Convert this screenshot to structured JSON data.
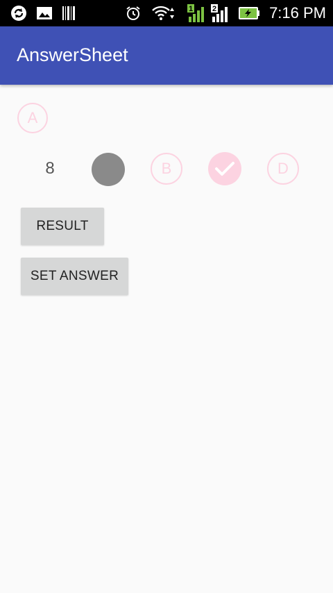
{
  "status_bar": {
    "time": "7:16 PM",
    "icons": [
      "sync-icon",
      "image-icon",
      "barcode-icon",
      "alarm-icon",
      "wifi-icon",
      "signal-sim1-icon",
      "signal-sim2-icon",
      "battery-charging-icon"
    ],
    "sim1_label": "1",
    "sim2_label": "2"
  },
  "app_bar": {
    "title": "AnswerSheet",
    "color": "#3f51b5"
  },
  "answer_sheet": {
    "first_option_label": "A",
    "question_number": "8",
    "options": [
      {
        "label": "",
        "state": "filled-grey"
      },
      {
        "label": "B",
        "state": "outline"
      },
      {
        "label": "",
        "state": "checked"
      },
      {
        "label": "D",
        "state": "outline"
      }
    ],
    "bubble_color": "#fcd3e1",
    "filled_color": "#8a8a8a"
  },
  "buttons": {
    "result_label": "RESULT",
    "set_answer_label": "SET ANSWER"
  }
}
